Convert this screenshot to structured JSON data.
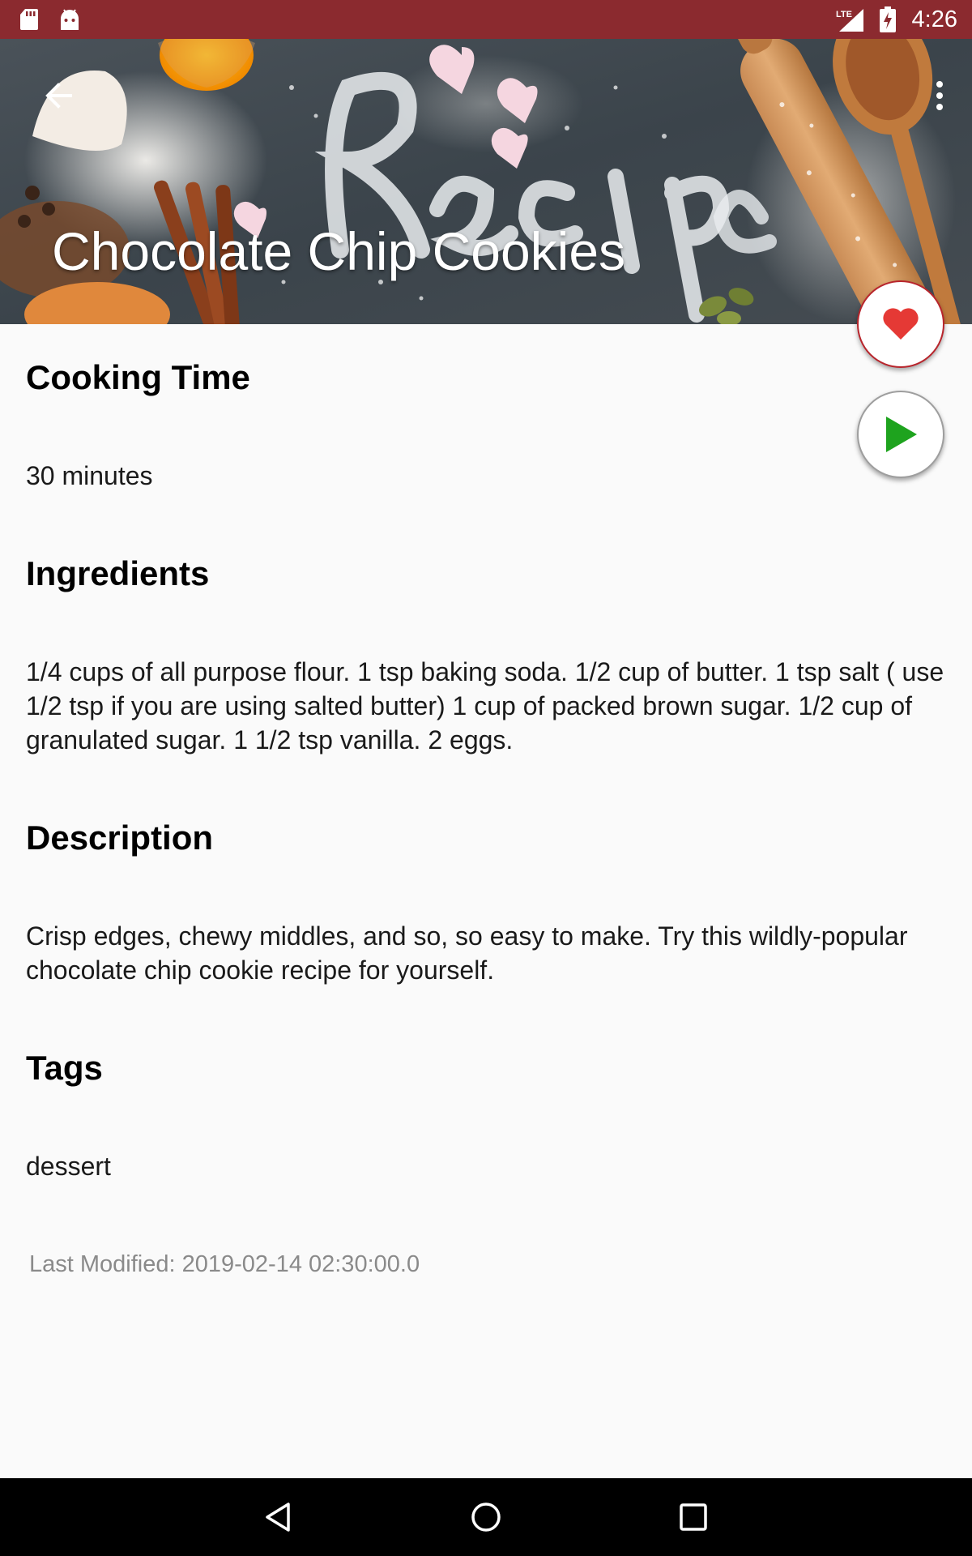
{
  "status_bar": {
    "time": "4:26",
    "network_label": "LTE",
    "icons": [
      "sd-card-icon",
      "android-icon",
      "signal-icon",
      "battery-charging-icon"
    ],
    "background_color": "#8b2a2f"
  },
  "header": {
    "title": "Chocolate Chip Cookies",
    "back_icon": "arrow-back-icon",
    "menu_icon": "more-vert-icon"
  },
  "fabs": {
    "favorite_icon": "heart-icon",
    "favorite_color": "#e53935",
    "play_icon": "play-icon",
    "play_color": "#1ea31e"
  },
  "sections": {
    "cooking_time": {
      "heading": "Cooking Time",
      "text": "30 minutes"
    },
    "ingredients": {
      "heading": "Ingredients",
      "text": "1/4 cups of all purpose flour. 1 tsp baking soda. 1/2 cup of butter. 1 tsp salt ( use 1/2 tsp if you are using salted butter) 1 cup of packed brown sugar. 1/2 cup of granulated sugar. 1 1/2 tsp vanilla. 2 eggs."
    },
    "description": {
      "heading": "Description",
      "text": "Crisp edges, chewy middles, and so, so easy to make. Try this wildly-popular chocolate chip cookie recipe for yourself."
    },
    "tags": {
      "heading": "Tags",
      "text": "dessert"
    }
  },
  "last_modified": "Last Modified: 2019-02-14 02:30:00.0",
  "nav_bar": {
    "icons": [
      "nav-back-icon",
      "nav-home-icon",
      "nav-recents-icon"
    ]
  }
}
